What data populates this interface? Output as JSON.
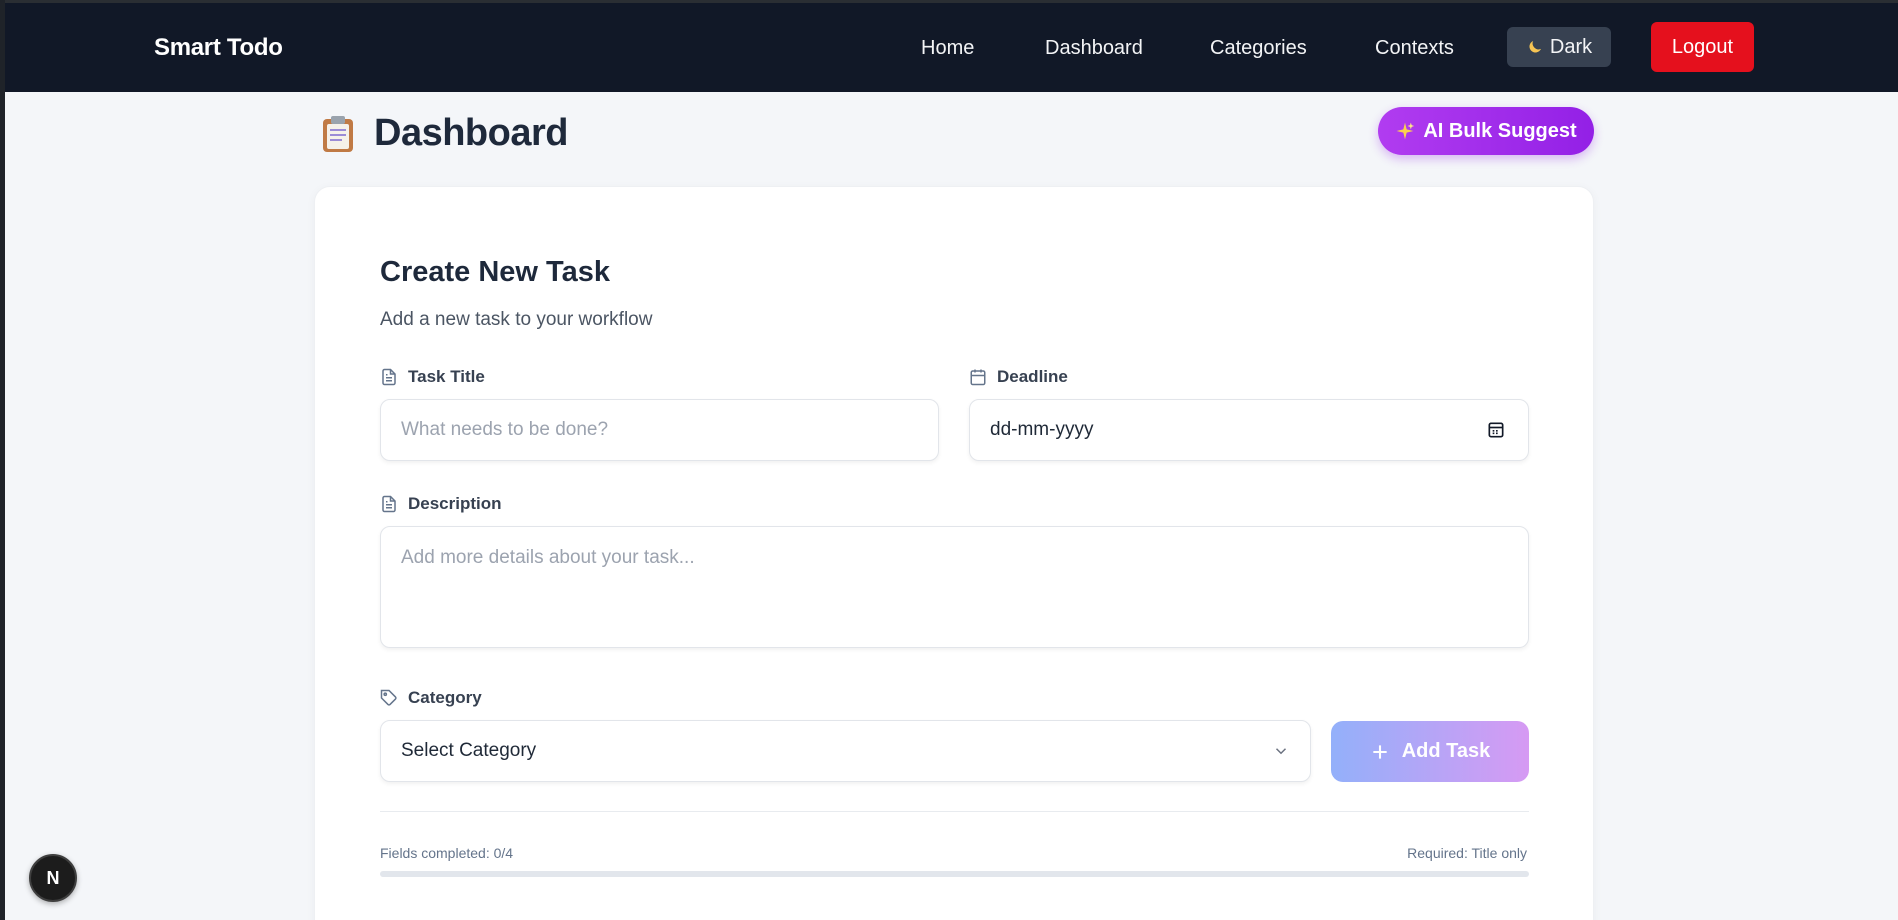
{
  "navbar": {
    "brand": "Smart Todo",
    "links": [
      "Home",
      "Dashboard",
      "Categories",
      "Contexts"
    ],
    "theme_toggle": {
      "icon": "moon-icon",
      "label": "Dark"
    },
    "logout_label": "Logout"
  },
  "page": {
    "icon": "clipboard-icon",
    "title": "Dashboard",
    "ai_button": {
      "icon": "sparkle-icon",
      "label": "AI Bulk Suggest"
    }
  },
  "form": {
    "title": "Create New Task",
    "subtitle": "Add a new task to your workflow",
    "task_title": {
      "icon": "document-icon",
      "label": "Task Title",
      "placeholder": "What needs to be done?",
      "value": ""
    },
    "deadline": {
      "icon": "calendar-icon",
      "label": "Deadline",
      "placeholder": "dd-mm-yyyy",
      "value": ""
    },
    "description": {
      "icon": "document-icon",
      "label": "Description",
      "placeholder": "Add more details about your task...",
      "value": ""
    },
    "category": {
      "icon": "tag-icon",
      "label": "Category",
      "selected": "Select Category"
    },
    "submit_label": "Add Task",
    "progress_text": "Fields completed: 0/4",
    "progress_value": 0,
    "required_text": "Required: Title only"
  },
  "dev_badge": {
    "label": "N"
  },
  "colors": {
    "navbar_bg": "#111827",
    "logout_bg": "#e5101d",
    "ai_button": "#9320e6",
    "add_task_gradient": [
      "#93b0fa",
      "#d69af3"
    ]
  }
}
